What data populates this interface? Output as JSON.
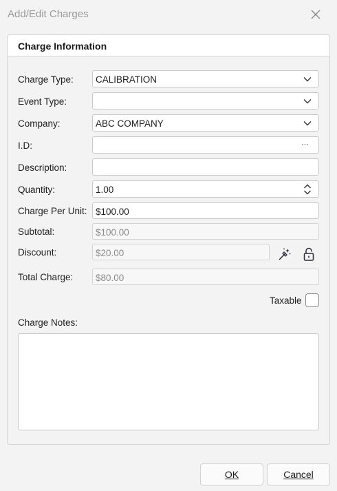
{
  "window": {
    "title": "Add/Edit Charges",
    "close_icon": "close-icon"
  },
  "panel": {
    "title": "Charge Information"
  },
  "form": {
    "charge_type": {
      "label": "Charge Type:",
      "value": "CALIBRATION"
    },
    "event_type": {
      "label": "Event Type:",
      "value": ""
    },
    "company": {
      "label": "Company:",
      "value": "ABC COMPANY"
    },
    "id": {
      "label": "I.D:",
      "value": "",
      "button": "···"
    },
    "description": {
      "label": "Description:",
      "value": ""
    },
    "quantity": {
      "label": "Quantity:",
      "value": "1.00"
    },
    "charge_per_unit": {
      "label": "Charge Per Unit:",
      "value": "$100.00"
    },
    "subtotal": {
      "label": "Subtotal:",
      "value": "$100.00"
    },
    "discount": {
      "label": "Discount:",
      "value": "$20.00"
    },
    "total_charge": {
      "label": "Total Charge:",
      "value": "$80.00"
    },
    "taxable": {
      "label": "Taxable",
      "checked": false
    },
    "charge_notes": {
      "label": "Charge Notes:",
      "value": ""
    }
  },
  "buttons": {
    "ok": "OK",
    "cancel": "Cancel"
  },
  "icons": {
    "discount_wand": "magic-wand-icon",
    "discount_lock": "unlock-icon"
  },
  "colors": {
    "background": "#f3f3f3",
    "field_border": "#c9c9c9",
    "disabled_text": "#8a8a8a"
  }
}
